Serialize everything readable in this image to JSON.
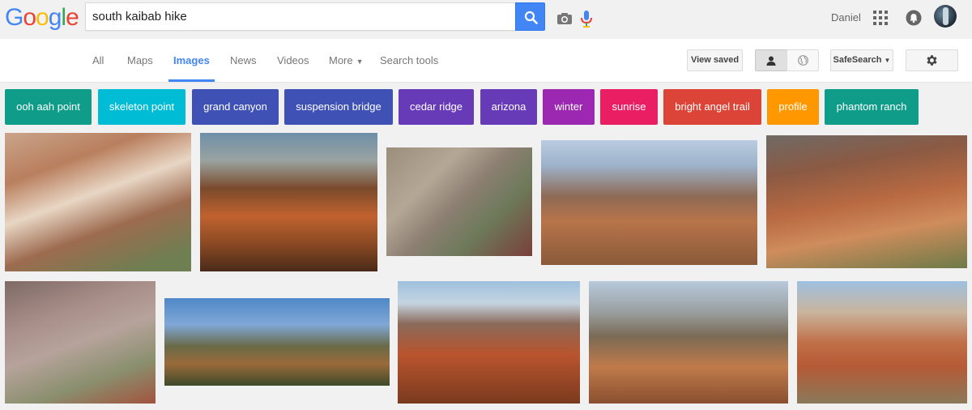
{
  "logo": {
    "letters": [
      "G",
      "o",
      "o",
      "g",
      "l",
      "e"
    ],
    "colors": [
      "#4285f4",
      "#ea4335",
      "#fbbc05",
      "#4285f4",
      "#34a853",
      "#ea4335"
    ]
  },
  "search": {
    "query": "south kaibab hike",
    "camera_icon": "camera-icon",
    "mic_icon": "mic-icon",
    "button_icon": "search-icon",
    "button_color": "#4285f4"
  },
  "account": {
    "user_name": "Daniel",
    "apps_icon": "apps-grid-icon",
    "notifications_icon": "notifications-icon"
  },
  "nav": {
    "tabs": [
      {
        "label": "All"
      },
      {
        "label": "Maps"
      },
      {
        "label": "Images",
        "active": true
      },
      {
        "label": "News"
      },
      {
        "label": "Videos"
      },
      {
        "label": "More"
      },
      {
        "label": "Search tools"
      }
    ],
    "view_saved": "View saved",
    "safesearch": "SafeSearch",
    "settings_icon": "gear-icon",
    "accent_color": "#4285f4"
  },
  "chips": [
    {
      "label": "ooh aah point",
      "color": "#0f9d8a"
    },
    {
      "label": "skeleton point",
      "color": "#00bcd4"
    },
    {
      "label": "grand canyon",
      "color": "#3f51b5"
    },
    {
      "label": "suspension bridge",
      "color": "#3f51b5"
    },
    {
      "label": "cedar ridge",
      "color": "#673ab7"
    },
    {
      "label": "arizona",
      "color": "#673ab7"
    },
    {
      "label": "winter",
      "color": "#9c27b0"
    },
    {
      "label": "sunrise",
      "color": "#e91e63"
    },
    {
      "label": "bright angel trail",
      "color": "#db4437"
    },
    {
      "label": "profile",
      "color": "#ff9800"
    },
    {
      "label": "phantom ranch",
      "color": "#0f9d8a"
    }
  ],
  "images": [
    {
      "subject": "canyon cliff switchbacks with hikers"
    },
    {
      "subject": "red trail ridge at sunrise"
    },
    {
      "subject": "aerial view of river and delta"
    },
    {
      "subject": "hikers on canyon rim trail"
    },
    {
      "subject": "red dirt switchback trail"
    },
    {
      "subject": "steep canyon wall and trail"
    },
    {
      "subject": "hiker with walking stick on trail"
    },
    {
      "subject": "hiker walking down red ridge"
    },
    {
      "subject": "rocky trail descending into canyon"
    },
    {
      "subject": "layered canyon wall and mesas"
    }
  ]
}
